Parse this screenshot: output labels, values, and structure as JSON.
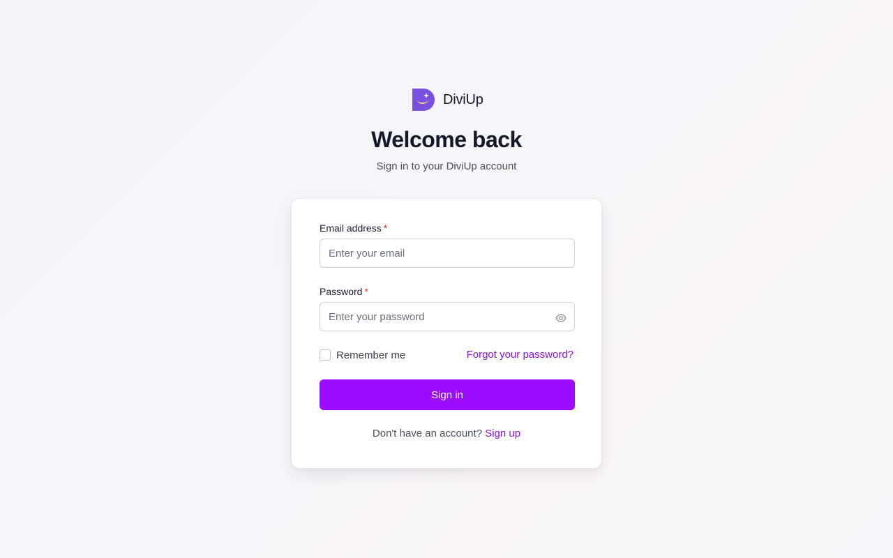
{
  "brand": {
    "name": "DiviUp",
    "logo_icon": "diviup-logo-icon",
    "logo_colors": {
      "primary": "#7b4fe0",
      "smile": "#f2d58a"
    }
  },
  "heading": {
    "title": "Welcome back",
    "subtitle": "Sign in to your DiviUp account"
  },
  "form": {
    "email": {
      "label": "Email address",
      "required_marker": "*",
      "placeholder": "Enter your email",
      "value": ""
    },
    "password": {
      "label": "Password",
      "required_marker": "*",
      "placeholder": "Enter your password",
      "value": "",
      "toggle_icon": "eye-icon"
    },
    "remember_me": {
      "label": "Remember me",
      "checked": false
    },
    "forgot_link": "Forgot your password?",
    "submit_label": "Sign in"
  },
  "footer": {
    "prompt": "Don't have an account?",
    "signup_link": "Sign up"
  },
  "colors": {
    "accent": "#9b0bff",
    "link": "#8a0fd6",
    "required": "#d22a2a"
  }
}
